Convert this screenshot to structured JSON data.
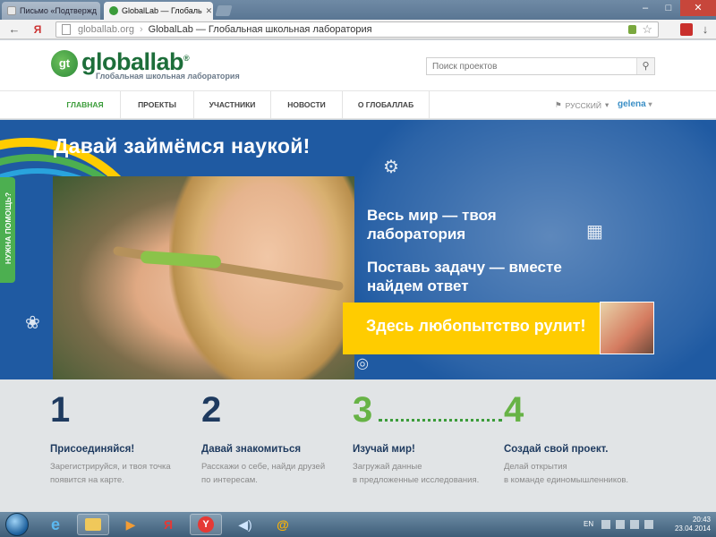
{
  "browser": {
    "tabs": [
      {
        "label": "Письмо «Подтвержд",
        "state": "inactive"
      },
      {
        "label": "GlobalLab — Глобаль",
        "state": "active"
      }
    ],
    "address": {
      "host": "globallab.org",
      "title": "GlobalLab — Глобальная школьная лаборатория"
    },
    "window_controls": [
      "–",
      "□",
      "✕"
    ]
  },
  "site": {
    "logo_mark": "gt",
    "logo_text": "globallab",
    "logo_reg": "®",
    "logo_subtitle": "Глобальная школьная лаборатория",
    "search_placeholder": "Поиск проектов",
    "nav": [
      {
        "label": "ГЛАВНАЯ",
        "active": true
      },
      {
        "label": "ПРОЕКТЫ",
        "active": false
      },
      {
        "label": "УЧАСТНИКИ",
        "active": false
      },
      {
        "label": "НОВОСТИ",
        "active": false
      },
      {
        "label": "О ГЛОБАЛЛАБ",
        "active": false
      }
    ],
    "language": "РУССКИЙ",
    "user": "gelena"
  },
  "hero": {
    "title": "Давай займёмся наукой!",
    "line1": "Весь мир — твоя лаборатория",
    "line2": "Поставь задачу — вместе найдем ответ",
    "banner": "Здесь любопытство рулит!",
    "help_tab": "НУЖНА ПОМОЩЬ?"
  },
  "steps": [
    {
      "number": "1",
      "heading": "Присоединяйся!",
      "desc1": "Зарегистрируйся, и твоя точка",
      "desc2": "появится на карте."
    },
    {
      "number": "2",
      "heading": "Давай знакомиться",
      "desc1": "Расскажи о себе, найди друзей",
      "desc2": "по интересам."
    },
    {
      "number": "3",
      "heading": "Изучай мир!",
      "desc1": "Загружай данные",
      "desc2": "в предложенные исследования."
    },
    {
      "number": "4",
      "heading": "Создай свой проект.",
      "desc1": "Делай открытия",
      "desc2": "в команде единомышленников."
    }
  ],
  "taskbar": {
    "lang": "EN",
    "time": "20:43",
    "date": "23.04.2014"
  },
  "colors": {
    "hero_blue": "#1f5aa2",
    "banner_yellow": "#ffcc00",
    "accent_green": "#3b9c3a",
    "step_navy": "#1e3a5f"
  }
}
